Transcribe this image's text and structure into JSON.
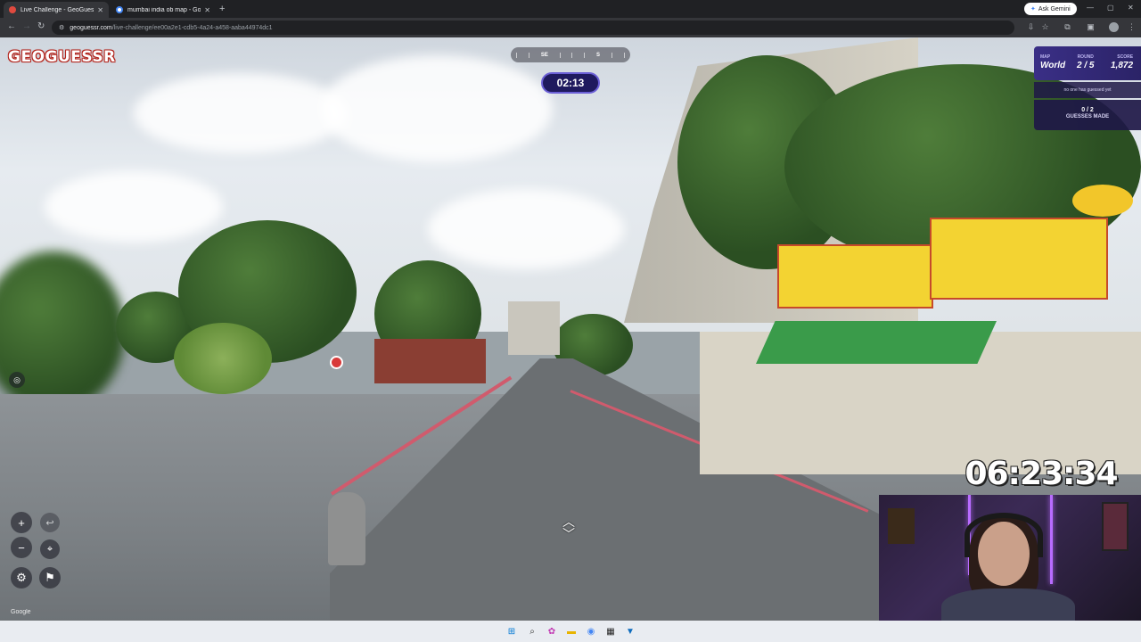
{
  "browser": {
    "tabs": [
      {
        "title": "Live Challenge - GeoGuessr",
        "active": true,
        "icon": "location-pin-icon"
      },
      {
        "title": "mumbai india ob map - Google",
        "active": false,
        "icon": "google-icon"
      }
    ],
    "new_tab": "+",
    "gemini_label": "Ask Gemini",
    "url_host": "geoguessr.com",
    "url_path": "/live-challenge/ee00a2e1-cdb5-4a24-a458-aaba44974dc1"
  },
  "game": {
    "logo": "GEOGUESSR",
    "compass": {
      "left": "SE",
      "right": "S"
    },
    "timer": "02:13",
    "status": {
      "map_label": "MAP",
      "map_value": "World",
      "round_label": "ROUND",
      "round_value": "2 / 5",
      "score_label": "SCORE",
      "score_value": "1,872"
    },
    "guessed_note": "no one has guessed yet",
    "guesses_count": "0 / 2",
    "guesses_label": "GUESSES MADE",
    "controls": {
      "zoom_in": "+",
      "zoom_out": "−",
      "undo": "↩"
    },
    "google_mark": "Google"
  },
  "stream_overlay": {
    "clock": "06:23:34"
  }
}
